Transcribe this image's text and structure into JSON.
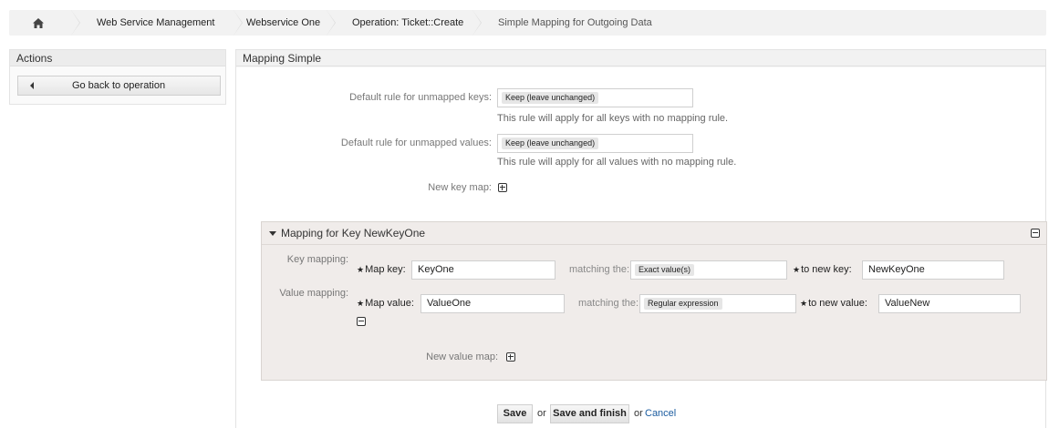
{
  "breadcrumb": {
    "home_icon": "home-icon",
    "items": [
      "Web Service Management",
      "Webservice One",
      "Operation: Ticket::Create",
      "Simple Mapping for Outgoing Data"
    ]
  },
  "sidebar": {
    "title": "Actions",
    "back_button": "Go back to operation"
  },
  "main": {
    "title": "Mapping Simple",
    "default_keys": {
      "label": "Default rule for unmapped keys:",
      "value": "Keep (leave unchanged)",
      "hint": "This rule will apply for all keys with no mapping rule."
    },
    "default_values": {
      "label": "Default rule for unmapped values:",
      "value": "Keep (leave unchanged)",
      "hint": "This rule will apply for all values with no mapping rule."
    },
    "new_key_map": "New key map:"
  },
  "panel": {
    "title": "Mapping for Key NewKeyOne",
    "key_mapping_label": "Key mapping:",
    "map_key_label": "Map key:",
    "map_key_value": "KeyOne",
    "key_matching_label": "matching the:",
    "key_matching_value": "Exact value(s)",
    "to_new_key_label": "to new key:",
    "to_new_key_value": "NewKeyOne",
    "value_mapping_label": "Value mapping:",
    "map_value_label": "Map value:",
    "map_value_value": "ValueOne",
    "value_matching_label": "matching the:",
    "value_matching_value": "Regular expression",
    "to_new_value_label": "to new value:",
    "to_new_value_value": "ValueNew",
    "new_value_map": "New value map:"
  },
  "footer": {
    "save": "Save",
    "or1": "or",
    "save_finish": "Save and finish",
    "or2": "or",
    "cancel": "Cancel"
  },
  "colors": {
    "link": "#1a5b9f",
    "panel_bg": "#f0ecea",
    "header_bg": "#ececec"
  }
}
